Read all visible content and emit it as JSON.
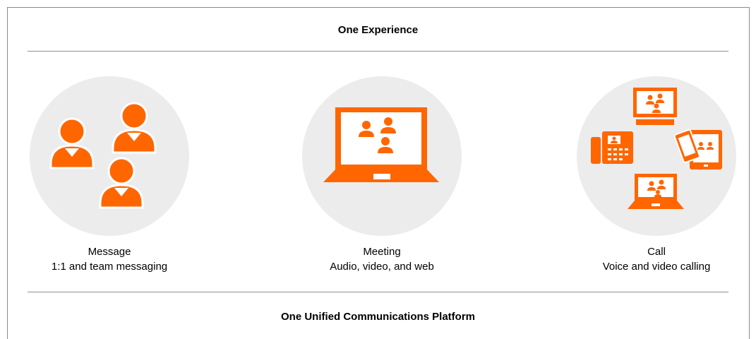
{
  "headings": {
    "top": "One Experience",
    "bottom": "One Unified Communications Platform"
  },
  "services": [
    {
      "title": "Message",
      "description": "1:1 and team messaging",
      "icon": "people-group-icon"
    },
    {
      "title": "Meeting",
      "description": "Audio, video, and web",
      "icon": "laptop-video-meeting-icon"
    },
    {
      "title": "Call",
      "description": "Voice and video calling",
      "icon": "multi-device-calling-icon"
    }
  ],
  "colors": {
    "accent": "#ff6600",
    "circle": "#ececec",
    "rule": "#8f8f8f"
  }
}
